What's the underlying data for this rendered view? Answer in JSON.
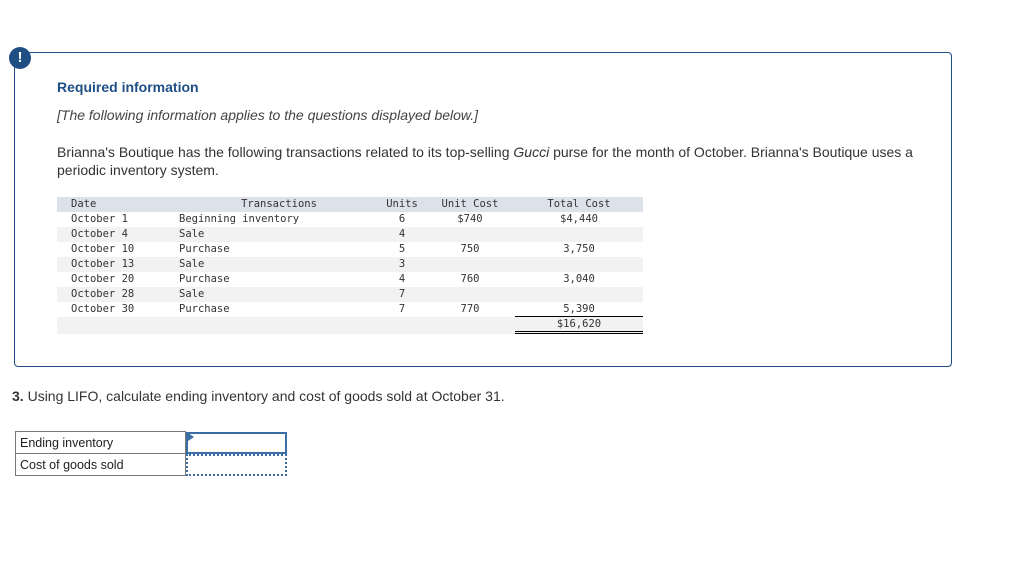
{
  "alert": {
    "icon": "exclamation-icon",
    "glyph": "!"
  },
  "info": {
    "title": "Required information",
    "note": "[The following information applies to the questions displayed below.]",
    "body_before": "Brianna's Boutique has the following transactions related to its top-selling ",
    "body_italic": "Gucci",
    "body_after": " purse for the month of October. Brianna's Boutique uses a periodic inventory system."
  },
  "table": {
    "headers": {
      "date": "Date",
      "transactions": "Transactions",
      "units": "Units",
      "unit_cost": "Unit Cost",
      "total_cost": "Total Cost"
    },
    "rows": [
      {
        "date": "October 1",
        "transaction": "Beginning inventory",
        "units": "6",
        "unit_cost": "$740",
        "total_cost": "$4,440"
      },
      {
        "date": "October 4",
        "transaction": "Sale",
        "units": "4",
        "unit_cost": "",
        "total_cost": ""
      },
      {
        "date": "October 10",
        "transaction": "Purchase",
        "units": "5",
        "unit_cost": "750",
        "total_cost": "3,750"
      },
      {
        "date": "October 13",
        "transaction": "Sale",
        "units": "3",
        "unit_cost": "",
        "total_cost": ""
      },
      {
        "date": "October 20",
        "transaction": "Purchase",
        "units": "4",
        "unit_cost": "760",
        "total_cost": "3,040"
      },
      {
        "date": "October 28",
        "transaction": "Sale",
        "units": "7",
        "unit_cost": "",
        "total_cost": ""
      },
      {
        "date": "October 30",
        "transaction": "Purchase",
        "units": "7",
        "unit_cost": "770",
        "total_cost": "5,390"
      }
    ],
    "grand_total": "$16,620"
  },
  "question": {
    "number": "3.",
    "text": " Using LIFO, calculate ending inventory and cost of goods sold at October 31."
  },
  "answers": [
    {
      "label": "Ending inventory",
      "value": ""
    },
    {
      "label": "Cost of goods sold",
      "value": ""
    }
  ]
}
